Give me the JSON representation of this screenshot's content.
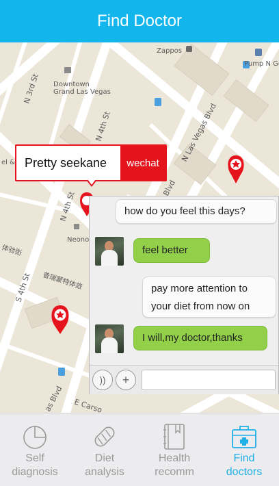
{
  "header": {
    "title": "Find Doctor"
  },
  "map": {
    "streets": [
      "N 3rd St",
      "N 4th St",
      "N 4th St",
      "N 4th St",
      "S 4th St",
      "N Las Vegas Blvd",
      "Blvd",
      "as Blvd",
      "E Carso"
    ],
    "pois": [
      "Zappos",
      "Downtown Grand Las Vegas",
      "Pump N Go",
      "Neono",
      "el &",
      "普瑞蒙特体旅",
      "体验街"
    ],
    "markers": [
      "doctor-marker",
      "doctor-marker",
      "doctor-marker"
    ]
  },
  "popup": {
    "name": "Pretty seekane",
    "action": "wechat"
  },
  "chat": {
    "messages": [
      {
        "side": "right",
        "text": "how do you feel this days?"
      },
      {
        "side": "left",
        "text": "feel better"
      },
      {
        "side": "right",
        "line1": "pay more attention to",
        "line2": "your diet from now on"
      },
      {
        "side": "left",
        "text": "I will,my doctor,thanks"
      }
    ],
    "input": {
      "placeholder": "",
      "value": ""
    }
  },
  "tabs": [
    {
      "line1": "Self",
      "line2": "diagnosis",
      "icon": "pie-chart-icon",
      "active": false
    },
    {
      "line1": "Diet",
      "line2": "analysis",
      "icon": "bread-icon",
      "active": false
    },
    {
      "line1": "Health",
      "line2": "recomm",
      "icon": "book-icon",
      "active": false
    },
    {
      "line1": "Find",
      "line2": "doctors",
      "icon": "medical-kit-icon",
      "active": true
    }
  ],
  "colors": {
    "header": "#12b6ec",
    "accent": "#20b0e8",
    "marker": "#e5141c",
    "chat_green": "#92d04a"
  }
}
